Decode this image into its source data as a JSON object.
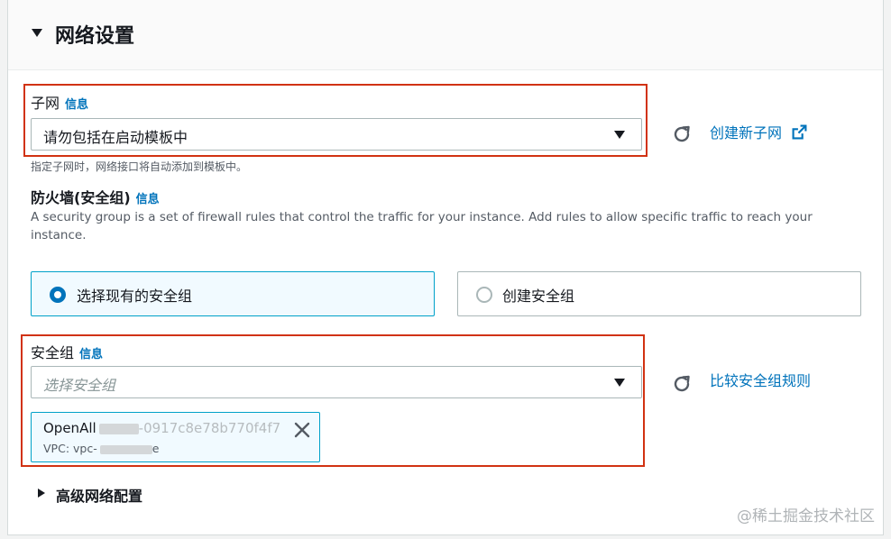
{
  "section": {
    "title": "网络设置"
  },
  "info_label": "信息",
  "subnet": {
    "label": "子网",
    "selected": "请勿包括在启动模板中",
    "hint": "指定子网时，网络接口将自动添加到模板中。",
    "create_link": "创建新子网"
  },
  "firewall": {
    "label": "防火墙(安全组)",
    "description": "A security group is a set of firewall rules that control the traffic for your instance. Add rules to allow specific traffic to reach your instance.",
    "options": [
      {
        "label": "选择现有的安全组",
        "selected": true
      },
      {
        "label": "创建安全组",
        "selected": false
      }
    ]
  },
  "security_group": {
    "label": "安全组",
    "placeholder": "选择安全组",
    "compare_link": "比较安全组规则",
    "token": {
      "name_visible": "OpenAll",
      "id_visible": "-0917c8e78b770f4f7",
      "vpc_prefix": "VPC: vpc-",
      "vpc_suffix": "e"
    }
  },
  "advanced": {
    "label": "高级网络配置"
  },
  "watermark": "@稀土掘金技术社区",
  "colors": {
    "link": "#0073bb",
    "highlight": "#d13212",
    "selected_tile": "#f1faff"
  },
  "icons": [
    "caret-down-icon",
    "refresh-icon",
    "external-link-icon",
    "radio-icon",
    "close-icon",
    "caret-right-icon"
  ]
}
